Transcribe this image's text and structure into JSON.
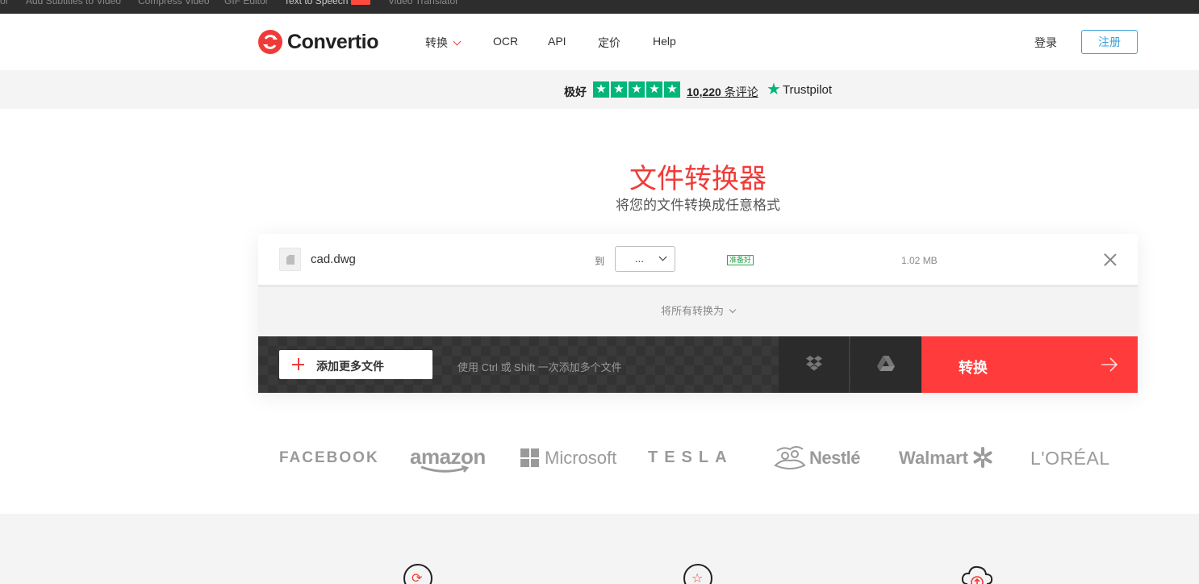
{
  "top_links": [
    {
      "label": "or"
    },
    {
      "label": "Add Subtitles to Video"
    },
    {
      "label": "Compress Video"
    },
    {
      "label": "GIF Editor"
    },
    {
      "label": "Text to Speech"
    },
    {
      "label": "Video Translator"
    }
  ],
  "header": {
    "logo_text": "Convertio",
    "nav": [
      {
        "label": "转换"
      },
      {
        "label": "OCR"
      },
      {
        "label": "API"
      },
      {
        "label": "定价"
      },
      {
        "label": "Help"
      }
    ],
    "login_label": "登录",
    "signup_label": "注册"
  },
  "trustpilot": {
    "rating_word": "极好",
    "review_count": "10,220",
    "review_suffix": "条评论",
    "brand": "Trustpilot",
    "stars": 5
  },
  "hero": {
    "title": "文件转换器",
    "subtitle": "将您的文件转换成任意格式"
  },
  "converter": {
    "file": {
      "name": "cad.dwg",
      "to_label": "到",
      "format_value": "...",
      "status": "准备好",
      "size": "1.02 MB"
    },
    "convert_all_label": "将所有转换为",
    "add_files_label": "添加更多文件",
    "hint": "使用 Ctrl 或 Shift 一次添加多个文件",
    "convert_label": "转换"
  },
  "brands": [
    "FACEBOOK",
    "amazon",
    "Microsoft",
    "TESLA",
    "Nestlé",
    "Walmart",
    "L'ORÉAL"
  ],
  "colors": {
    "accent": "#ef3b38",
    "convert_button": "#ff3b3b",
    "trustpilot_green": "#00b67a",
    "signup_blue": "#3aa0d8",
    "status_green": "#2aa54b"
  }
}
